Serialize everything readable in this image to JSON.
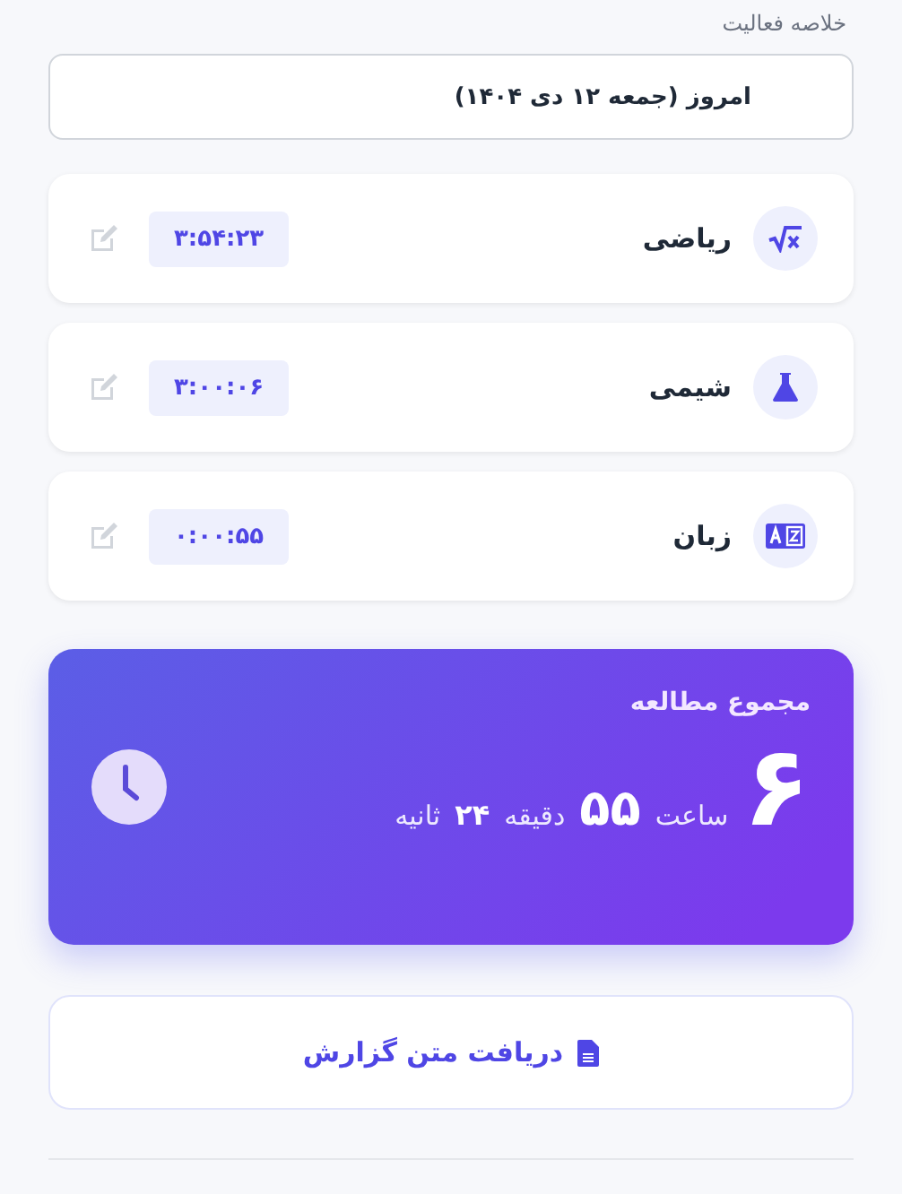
{
  "section_title": "خلاصه فعالیت",
  "date_label": "امروز (جمعه ۱۲ دی ۱۴۰۴)",
  "subjects": [
    {
      "kind": "math",
      "name": "ریاضی",
      "time": "۳:۵۴:۲۳"
    },
    {
      "kind": "chemistry",
      "name": "شیمی",
      "time": "۳:۰۰:۰۶"
    },
    {
      "kind": "language",
      "name": "زبان",
      "time": "۰:۰۰:۵۵"
    }
  ],
  "total": {
    "title": "مجموع مطالعه",
    "hours": "۶",
    "hours_unit": "ساعت",
    "minutes": "۵۵",
    "minutes_unit": "دقیقه",
    "seconds": "۲۴",
    "seconds_unit": "ثانیه"
  },
  "report_button": "دریافت متن گزارش"
}
